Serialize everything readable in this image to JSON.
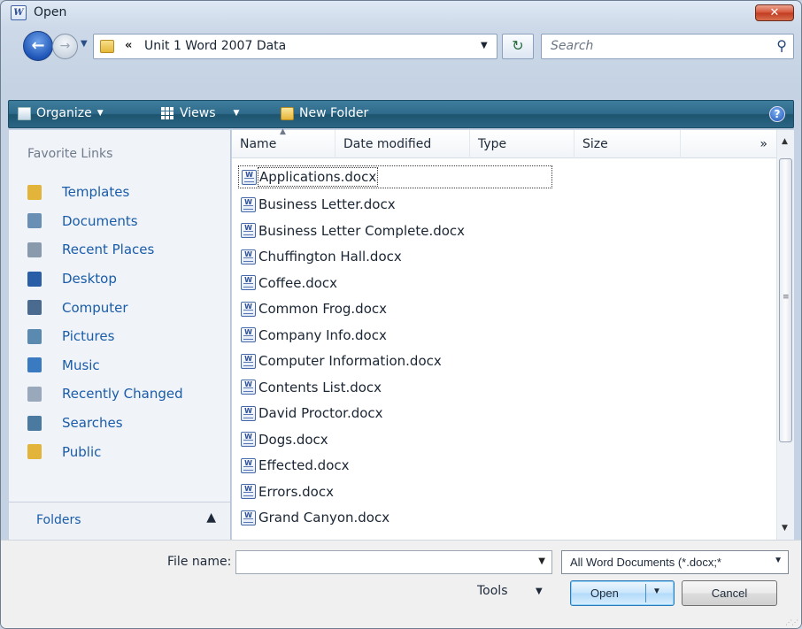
{
  "window": {
    "title": "Open",
    "app_icon_letter": "W",
    "close_glyph": "✕"
  },
  "nav": {
    "back_glyph": "←",
    "forward_glyph": "→",
    "history_glyph": "▼"
  },
  "address": {
    "chevron": "«",
    "path": "Unit 1 Word 2007 Data",
    "dropdown_glyph": "▼"
  },
  "refresh": {
    "glyph": "↻"
  },
  "search": {
    "placeholder": "Search",
    "icon_glyph": "⚲"
  },
  "toolbar": {
    "organize_label": "Organize",
    "views_label": "Views",
    "new_folder_label": "New Folder",
    "caret": "▼",
    "help_glyph": "?"
  },
  "favorites": {
    "header": "Favorite Links",
    "items": [
      {
        "label": "Templates",
        "icon": "folder-icon",
        "color": "#e2b43a"
      },
      {
        "label": "Documents",
        "icon": "documents-icon",
        "color": "#6a8fb5"
      },
      {
        "label": "Recent Places",
        "icon": "recent-places-icon",
        "color": "#8a9aad"
      },
      {
        "label": "Desktop",
        "icon": "desktop-icon",
        "color": "#2a5fa8"
      },
      {
        "label": "Computer",
        "icon": "computer-icon",
        "color": "#4a6a90"
      },
      {
        "label": "Pictures",
        "icon": "pictures-icon",
        "color": "#5a8ab0"
      },
      {
        "label": "Music",
        "icon": "music-icon",
        "color": "#3a7ac0"
      },
      {
        "label": "Recently Changed",
        "icon": "recently-changed-icon",
        "color": "#9aa8bb"
      },
      {
        "label": "Searches",
        "icon": "searches-icon",
        "color": "#4a7aa0"
      },
      {
        "label": "Public",
        "icon": "folder-icon",
        "color": "#e2b43a"
      }
    ],
    "folders_label": "Folders",
    "folders_caret": "▲"
  },
  "columns": {
    "name": "Name",
    "date_modified": "Date modified",
    "type": "Type",
    "size": "Size",
    "more": "»",
    "sort_glyph": "▲"
  },
  "files": [
    "Applications.docx",
    "Business Letter.docx",
    "Business Letter Complete.docx",
    "Chuffington Hall.docx",
    "Coffee.docx",
    "Common Frog.docx",
    "Company Info.docx",
    "Computer Information.docx",
    "Contents List.docx",
    "David Proctor.docx",
    "Dogs.docx",
    "Effected.docx",
    "Errors.docx",
    "Grand Canyon.docx"
  ],
  "scroll": {
    "up": "▲",
    "down": "▼",
    "grip": "≡"
  },
  "footer": {
    "file_name_label": "File name:",
    "file_name_value": "",
    "filter": "All Word Documents (*.docx;*",
    "tools_label": "Tools",
    "open_label": "Open",
    "cancel_label": "Cancel",
    "dropdown_glyph": "▼"
  }
}
